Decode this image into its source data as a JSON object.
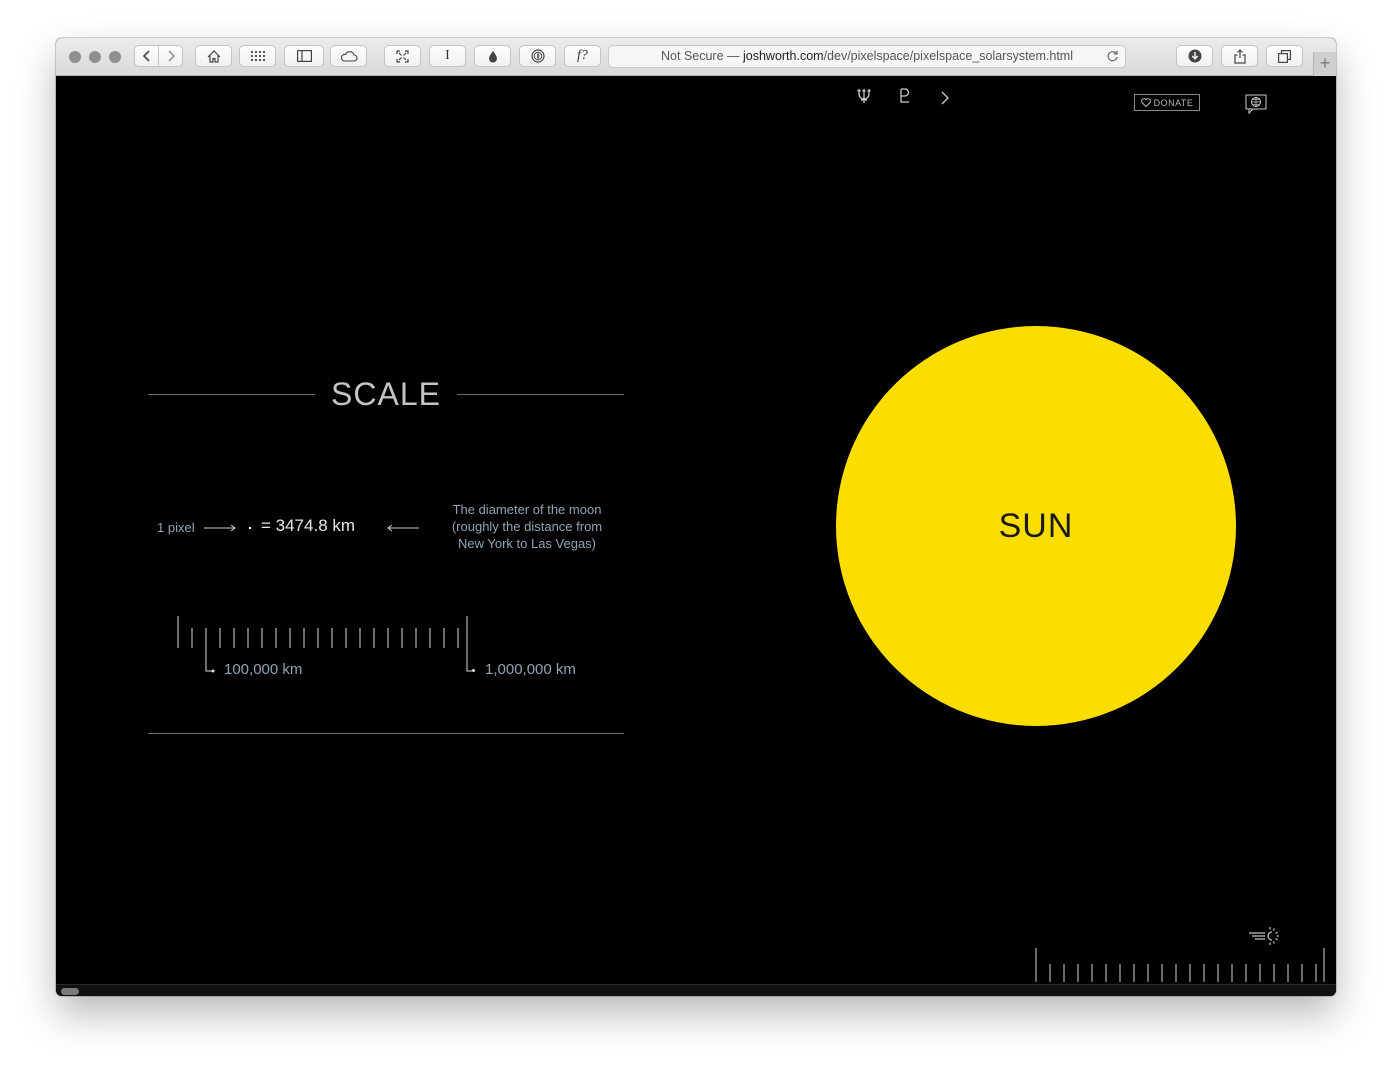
{
  "browser": {
    "url_prefix": "Not Secure — ",
    "url_host": "joshworth.com",
    "url_path": "/dev/pixelspace/pixelspace_solarsystem.html",
    "toolbar_icons": [
      "back-icon",
      "forward-icon",
      "home-icon",
      "grid-icon",
      "sidebar-icon",
      "cloud-icon",
      "fullscreen-icon",
      "text-cursor-icon",
      "ink-drop-icon",
      "onepassword-icon",
      "f-question-icon"
    ],
    "right_icons": [
      "download-icon",
      "share-icon",
      "tabs-icon"
    ],
    "new_tab_label": "+"
  },
  "topnav": {
    "icons": [
      "neptune-symbol-icon",
      "pluto-symbol-icon",
      "next-arrow-icon"
    ],
    "donate_label": "DONATE",
    "language_icon": "globe-icon"
  },
  "scale": {
    "title": "SCALE",
    "pixel_label": "1 pixel",
    "equals_value": "= 3474.8 km",
    "note_line1": "The diameter of the moon",
    "note_line2": "(roughly the distance from",
    "note_line3": "New York to Las Vegas)",
    "marker_small": "100,000 km",
    "marker_large": "1,000,000 km"
  },
  "sun": {
    "label": "SUN",
    "color": "#fcdd00"
  },
  "controls": {
    "speed_icon": "light-speed-icon"
  }
}
